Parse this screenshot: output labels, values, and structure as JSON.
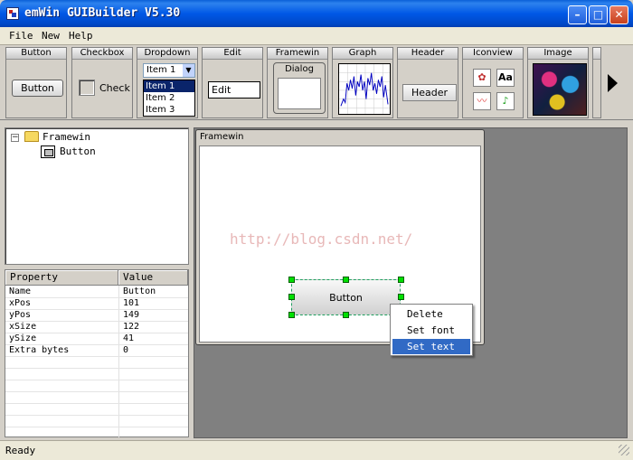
{
  "window": {
    "title": "emWin GUIBuilder V5.30",
    "min_symbol": "–",
    "max_symbol": "□",
    "close_symbol": "✕"
  },
  "menu": {
    "items": [
      "File",
      "New",
      "Help"
    ]
  },
  "toolbar": {
    "tools": [
      {
        "label": "Button",
        "preview": "Button"
      },
      {
        "label": "Checkbox",
        "preview": "Check"
      },
      {
        "label": "Dropdown",
        "selected": "Item 1",
        "options": [
          "Item 1",
          "Item 2",
          "Item 3"
        ]
      },
      {
        "label": "Edit",
        "preview": "Edit"
      },
      {
        "label": "Framewin",
        "preview": "Dialog"
      },
      {
        "label": "Graph"
      },
      {
        "label": "Header",
        "preview": "Header"
      },
      {
        "label": "Iconview",
        "icon_text": "Aa"
      },
      {
        "label": "Image"
      }
    ],
    "scroll_icon": "arrow-right-icon"
  },
  "tree": {
    "root": "Framewin",
    "child": "Button",
    "expander": "−"
  },
  "properties": {
    "headers": [
      "Property",
      "Value"
    ],
    "rows": [
      {
        "name": "Name",
        "value": "Button"
      },
      {
        "name": "xPos",
        "value": "101"
      },
      {
        "name": "yPos",
        "value": "149"
      },
      {
        "name": "xSize",
        "value": "122"
      },
      {
        "name": "ySize",
        "value": "41"
      },
      {
        "name": "Extra bytes",
        "value": "0"
      }
    ]
  },
  "canvas": {
    "framewin_title": "Framewin",
    "button_label": "Button",
    "watermark": "http://blog.csdn.net/"
  },
  "context_menu": {
    "items": [
      "Delete",
      "Set font",
      "Set text"
    ],
    "selected_index": 2
  },
  "status": {
    "text": "Ready"
  },
  "colors": {
    "title_bar": "#0058e6",
    "selection": "#316ac5",
    "handles": "#00e000",
    "workarea": "#808080"
  }
}
